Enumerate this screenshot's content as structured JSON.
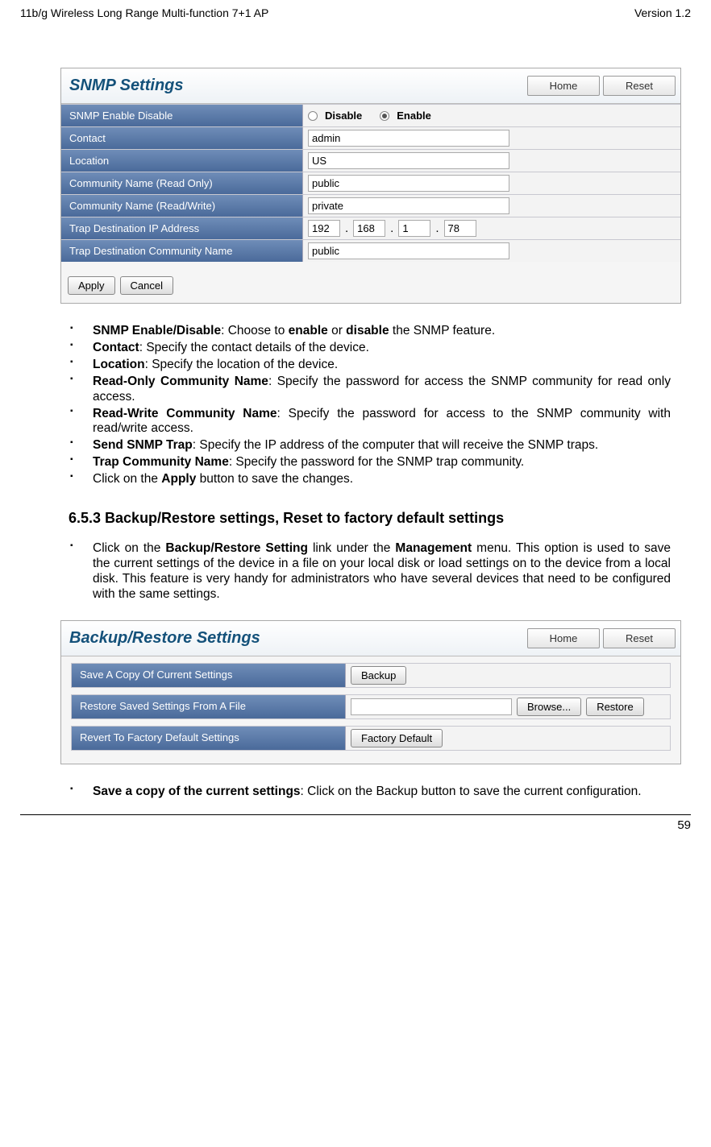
{
  "header": {
    "left": "11b/g Wireless Long Range Multi-function 7+1 AP",
    "right": "Version 1.2"
  },
  "snmp": {
    "title": "SNMP Settings",
    "home": "Home",
    "reset": "Reset",
    "rows": {
      "enable_lbl": "SNMP Enable Disable",
      "disable": "Disable",
      "enable": "Enable",
      "contact_lbl": "Contact",
      "contact_val": "admin",
      "location_lbl": "Location",
      "location_val": "US",
      "rocn_lbl": "Community Name (Read Only)",
      "rocn_val": "public",
      "rwcn_lbl": "Community Name (Read/Write)",
      "rwcn_val": "private",
      "trapip_lbl": "Trap Destination IP Address",
      "trapip": {
        "a": "192",
        "b": "168",
        "c": "1",
        "d": "78"
      },
      "trapcn_lbl": "Trap Destination Community Name",
      "trapcn_val": "public"
    },
    "apply": "Apply",
    "cancel": "Cancel"
  },
  "list1": {
    "i0_b": "SNMP Enable/Disable",
    "i0_t": ": Choose to ",
    "i0_b2": "enable",
    "i0_t2": " or ",
    "i0_b3": "disable",
    "i0_t3": " the SNMP feature.",
    "i1_b": "Contact",
    "i1_t": ": Specify the contact details of the device.",
    "i2_b": "Location",
    "i2_t": ": Specify the location of the device.",
    "i3_b": "Read-Only Community Name",
    "i3_t": ": Specify the password for access the SNMP community for read only access.",
    "i4_b": "Read-Write Community Name",
    "i4_t": ": Specify the password for access to the SNMP community with read/write access.",
    "i5_b": "Send SNMP Trap",
    "i5_t": ": Specify the IP address of the computer that will receive the SNMP traps.",
    "i6_b": "Trap Community Name",
    "i6_t": ": Specify the password for the SNMP trap community.",
    "i7_t1": "Click on the ",
    "i7_b": "Apply",
    "i7_t2": " button to save the changes."
  },
  "section": "6.5.3   Backup/Restore settings, Reset to factory default settings",
  "list2": {
    "i0_t1": "Click on the ",
    "i0_b1": "Backup/Restore Setting",
    "i0_t2": " link under the ",
    "i0_b2": "Management",
    "i0_t3": " menu. This option is used to save the current settings of the device in a file on your local disk or load settings on to the device from a local disk. This feature is very handy for administrators who have several devices that need to be configured with the same settings."
  },
  "backup": {
    "title": "Backup/Restore Settings",
    "home": "Home",
    "reset": "Reset",
    "r1_lbl": "Save A Copy Of Current Settings",
    "r1_btn": "Backup",
    "r2_lbl": "Restore Saved Settings From A File",
    "r2_browse": "Browse...",
    "r2_restore": "Restore",
    "r3_lbl": "Revert To Factory Default Settings",
    "r3_btn": "Factory Default"
  },
  "list3": {
    "i0_b": "Save a copy of the current settings",
    "i0_t": ": Click on the Backup button to save the current configuration."
  },
  "footer": "59"
}
